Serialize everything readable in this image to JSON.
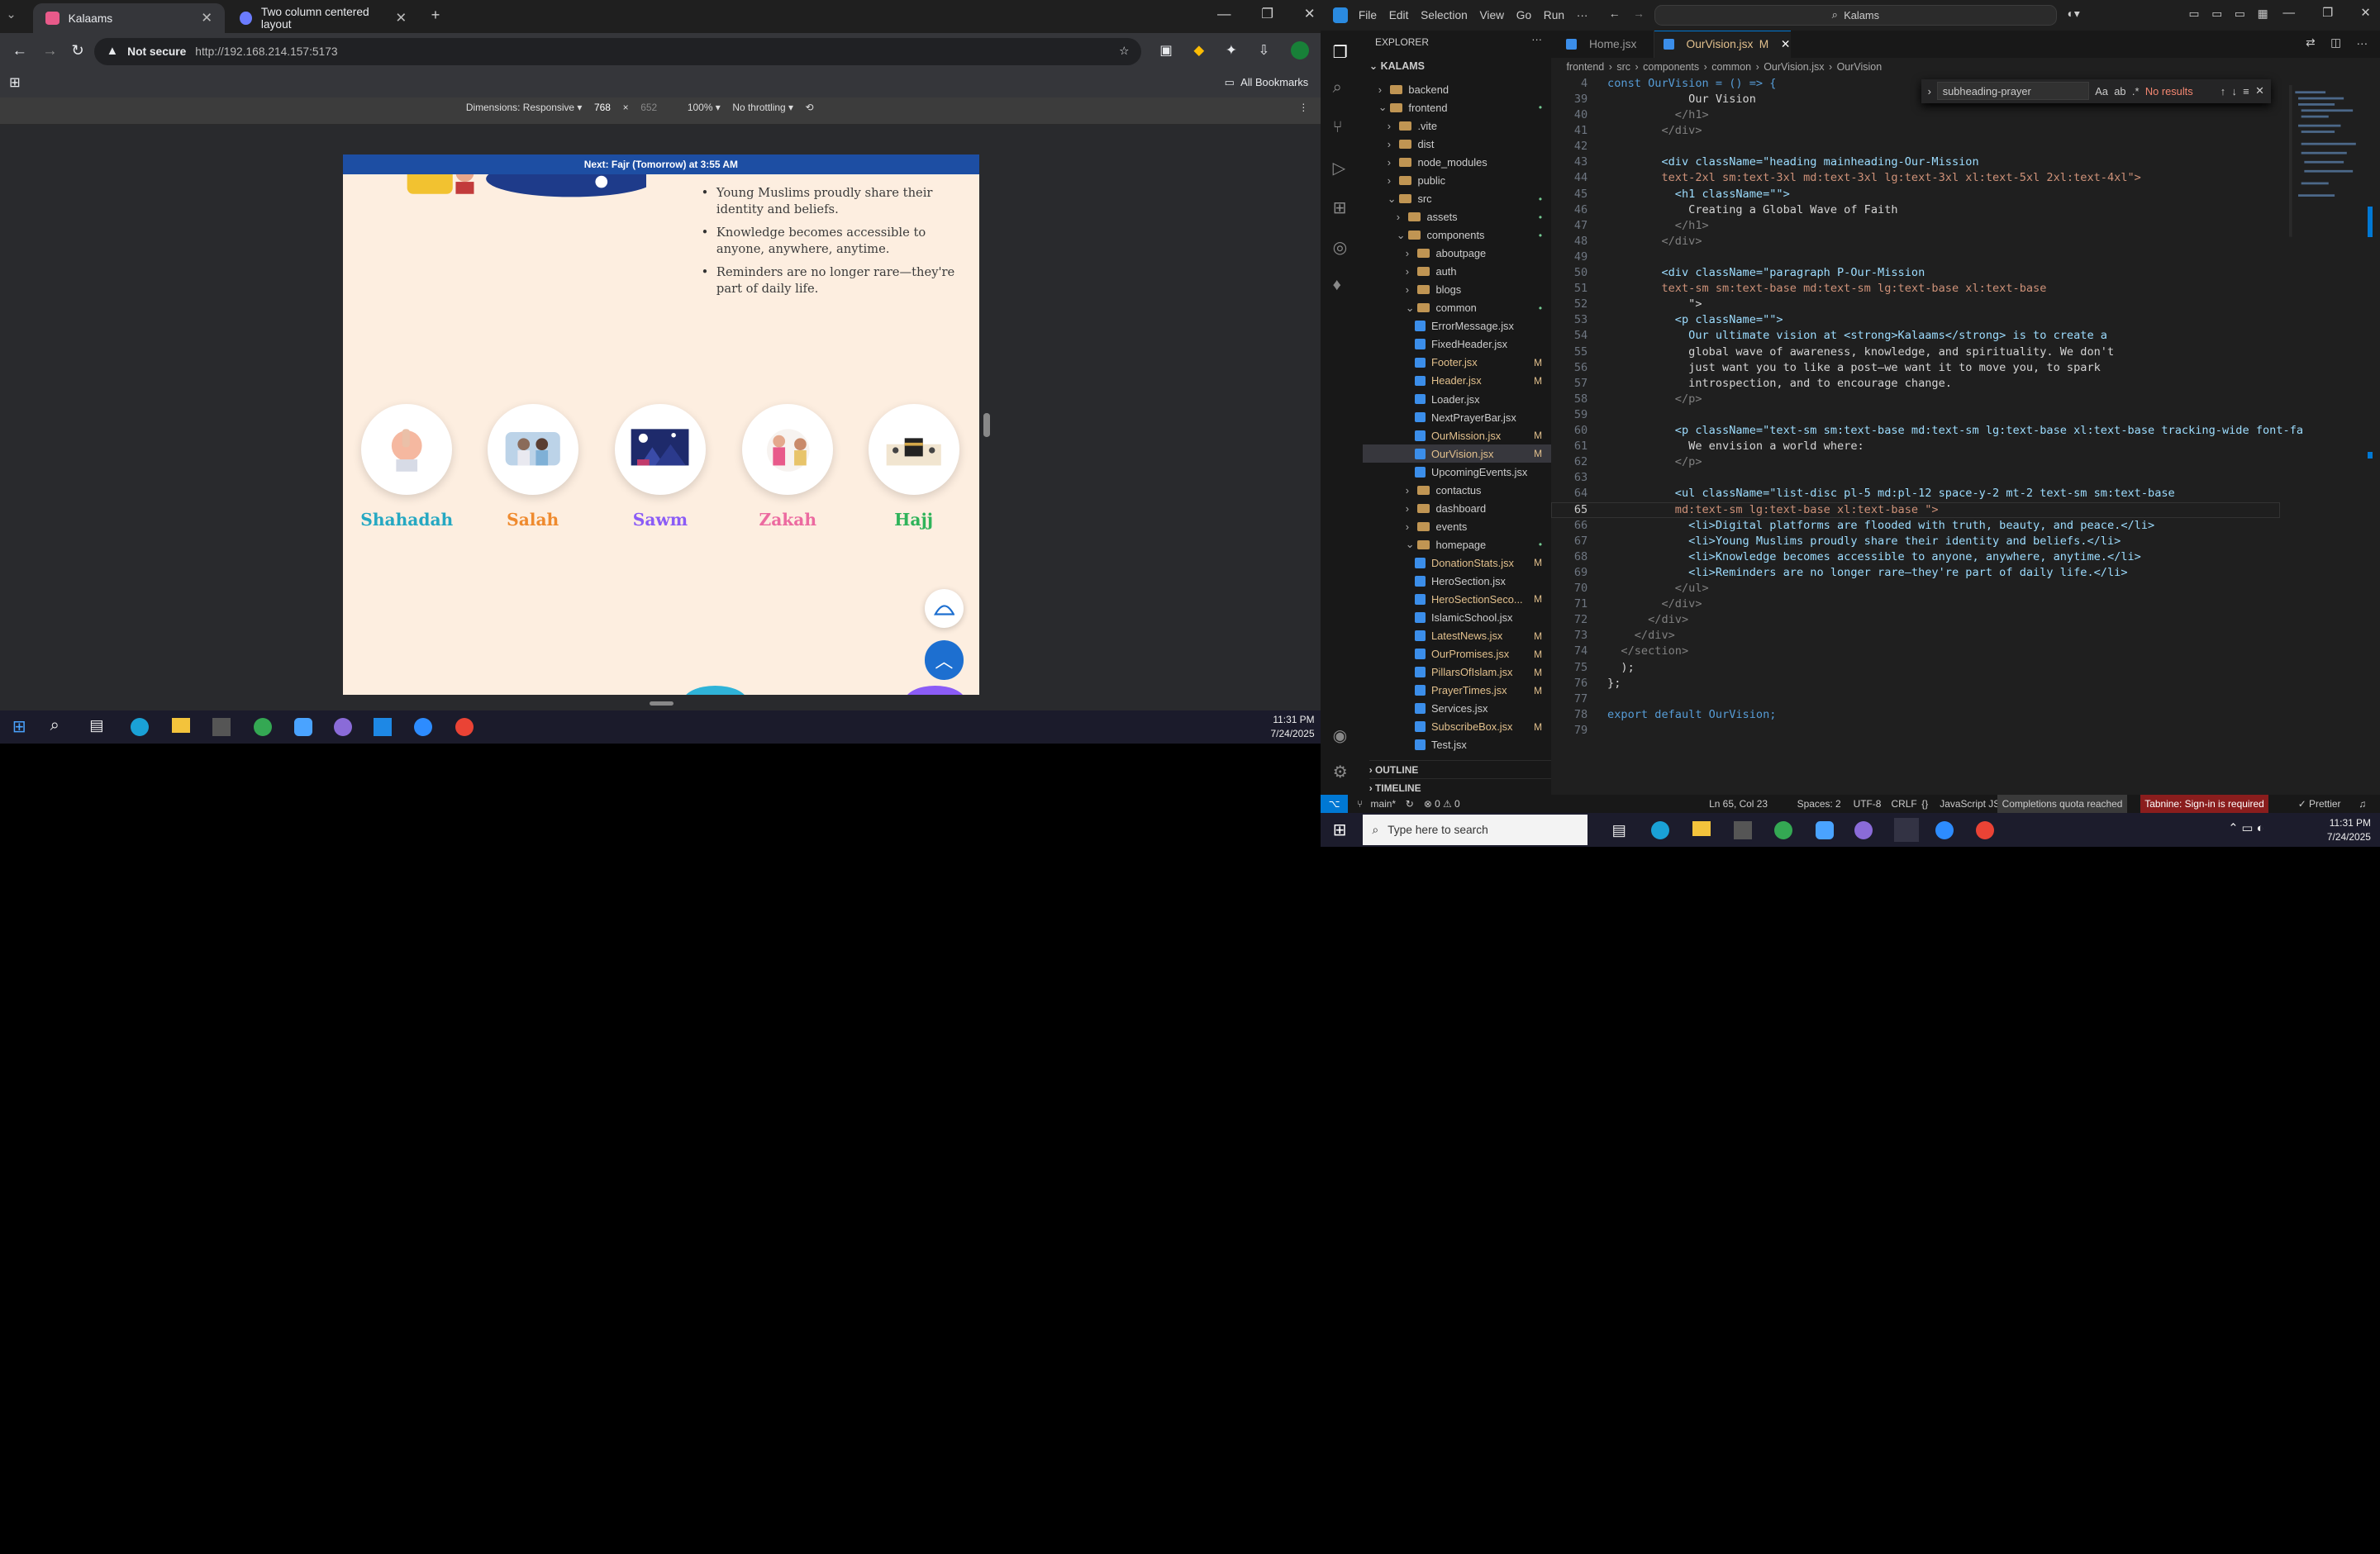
{
  "browser": {
    "tabs": [
      {
        "title": "Kalaams",
        "active": true
      },
      {
        "title": "Two column centered layout",
        "active": false
      }
    ],
    "new_tab": "+",
    "security": "Not secure",
    "url": "http://192.168.214.157:5173",
    "all_bookmarks": "All Bookmarks",
    "devtools": {
      "dimensions_label": "Dimensions: Responsive ▾",
      "width": "768",
      "times": "×",
      "height": "652",
      "zoom": "100% ▾",
      "throttle": "No throttling ▾"
    }
  },
  "site": {
    "prayer_bar": "Next: Fajr (Tomorrow) at 3:55 AM",
    "bullets": [
      "Young Muslims proudly share their identity and beliefs.",
      "Knowledge becomes accessible to anyone, anywhere, anytime.",
      "Reminders are no longer rare—they're part of daily life."
    ],
    "pillars": [
      {
        "label": "Shahadah",
        "color": "#26a8c2"
      },
      {
        "label": "Salah",
        "color": "#ef8a2e"
      },
      {
        "label": "Sawm",
        "color": "#8b5cf6"
      },
      {
        "label": "Zakah",
        "color": "#ec6aa0"
      },
      {
        "label": "Hajj",
        "color": "#2fb35a"
      }
    ]
  },
  "taskbar_left": {
    "time": "11:31 PM",
    "date": "7/24/2025"
  },
  "vscode": {
    "menu": [
      "File",
      "Edit",
      "Selection",
      "View",
      "Go",
      "Run",
      "···"
    ],
    "search": "Kalams",
    "explorer_title": "EXPLORER",
    "root": "KALAMS",
    "tree": [
      {
        "name": "backend",
        "type": "folder",
        "indent": 1,
        "arrow": "›"
      },
      {
        "name": "frontend",
        "type": "folder",
        "indent": 1,
        "arrow": "⌄",
        "badge": "•"
      },
      {
        "name": ".vite",
        "type": "folder",
        "indent": 2,
        "arrow": "›"
      },
      {
        "name": "dist",
        "type": "folder",
        "indent": 2,
        "arrow": "›"
      },
      {
        "name": "node_modules",
        "type": "folder",
        "indent": 2,
        "arrow": "›"
      },
      {
        "name": "public",
        "type": "folder",
        "indent": 2,
        "arrow": "›"
      },
      {
        "name": "src",
        "type": "folder",
        "indent": 2,
        "arrow": "⌄",
        "badge": "•"
      },
      {
        "name": "assets",
        "type": "folder",
        "indent": 3,
        "arrow": "›",
        "badge": "•"
      },
      {
        "name": "components",
        "type": "folder",
        "indent": 3,
        "arrow": "⌄",
        "badge": "•"
      },
      {
        "name": "aboutpage",
        "type": "folder",
        "indent": 4,
        "arrow": "›"
      },
      {
        "name": "auth",
        "type": "folder",
        "indent": 4,
        "arrow": "›"
      },
      {
        "name": "blogs",
        "type": "folder",
        "indent": 4,
        "arrow": "›"
      },
      {
        "name": "common",
        "type": "folder",
        "indent": 4,
        "arrow": "⌄",
        "badge": "•"
      },
      {
        "name": "ErrorMessage.jsx",
        "type": "file",
        "indent": 5
      },
      {
        "name": "FixedHeader.jsx",
        "type": "file",
        "indent": 5
      },
      {
        "name": "Footer.jsx",
        "type": "file",
        "indent": 5,
        "badge": "M"
      },
      {
        "name": "Header.jsx",
        "type": "file",
        "indent": 5,
        "badge": "M"
      },
      {
        "name": "Loader.jsx",
        "type": "file",
        "indent": 5
      },
      {
        "name": "NextPrayerBar.jsx",
        "type": "file",
        "indent": 5
      },
      {
        "name": "OurMission.jsx",
        "type": "file",
        "indent": 5,
        "badge": "M"
      },
      {
        "name": "OurVision.jsx",
        "type": "file",
        "indent": 5,
        "badge": "M",
        "selected": true
      },
      {
        "name": "UpcomingEvents.jsx",
        "type": "file",
        "indent": 5
      },
      {
        "name": "contactus",
        "type": "folder",
        "indent": 4,
        "arrow": "›"
      },
      {
        "name": "dashboard",
        "type": "folder",
        "indent": 4,
        "arrow": "›"
      },
      {
        "name": "events",
        "type": "folder",
        "indent": 4,
        "arrow": "›"
      },
      {
        "name": "homepage",
        "type": "folder",
        "indent": 4,
        "arrow": "⌄",
        "badge": "•"
      },
      {
        "name": "DonationStats.jsx",
        "type": "file",
        "indent": 5,
        "badge": "M"
      },
      {
        "name": "HeroSection.jsx",
        "type": "file",
        "indent": 5
      },
      {
        "name": "HeroSectionSeco...",
        "type": "file",
        "indent": 5,
        "badge": "M"
      },
      {
        "name": "IslamicSchool.jsx",
        "type": "file",
        "indent": 5
      },
      {
        "name": "LatestNews.jsx",
        "type": "file",
        "indent": 5,
        "badge": "M"
      },
      {
        "name": "OurPromises.jsx",
        "type": "file",
        "indent": 5,
        "badge": "M"
      },
      {
        "name": "PillarsOfIslam.jsx",
        "type": "file",
        "indent": 5,
        "badge": "M"
      },
      {
        "name": "PrayerTimes.jsx",
        "type": "file",
        "indent": 5,
        "badge": "M"
      },
      {
        "name": "Services.jsx",
        "type": "file",
        "indent": 5
      },
      {
        "name": "SubscribeBox.jsx",
        "type": "file",
        "indent": 5,
        "badge": "M"
      },
      {
        "name": "Test.jsx",
        "type": "file",
        "indent": 5
      }
    ],
    "outline": "OUTLINE",
    "timeline": "TIMELINE",
    "editor_tabs": [
      {
        "name": "Home.jsx",
        "active": false
      },
      {
        "name": "OurVision.jsx",
        "active": true,
        "badge": "M"
      }
    ],
    "breadcrumb": [
      "frontend",
      "src",
      "components",
      "common",
      "OurVision.jsx",
      "OurVision"
    ],
    "find": {
      "query": "subheading-prayer",
      "result": "No results"
    },
    "code_lines": [
      {
        "n": "4",
        "t": "const OurVision = () => {"
      },
      {
        "n": "39",
        "t": "            Our Vision"
      },
      {
        "n": "40",
        "t": "          </h1>"
      },
      {
        "n": "41",
        "t": "        </div>"
      },
      {
        "n": "42",
        "t": ""
      },
      {
        "n": "43",
        "t": "        <div className=\"heading mainheading-Our-Mission"
      },
      {
        "n": "44",
        "t": "        text-2xl sm:text-3xl md:text-3xl lg:text-3xl xl:text-5xl 2xl:text-4xl\">"
      },
      {
        "n": "45",
        "t": "          <h1 className=\"\">"
      },
      {
        "n": "46",
        "t": "            Creating a Global Wave of Faith"
      },
      {
        "n": "47",
        "t": "          </h1>"
      },
      {
        "n": "48",
        "t": "        </div>"
      },
      {
        "n": "49",
        "t": ""
      },
      {
        "n": "50",
        "t": "        <div className=\"paragraph P-Our-Mission"
      },
      {
        "n": "51",
        "t": "        text-sm sm:text-base md:text-sm lg:text-base xl:text-base"
      },
      {
        "n": "52",
        "t": "            \">"
      },
      {
        "n": "53",
        "t": "          <p className=\"\">"
      },
      {
        "n": "54",
        "t": "            Our ultimate vision at <strong>Kalaams</strong> is to create a"
      },
      {
        "n": "55",
        "t": "            global wave of awareness, knowledge, and spirituality. We don't"
      },
      {
        "n": "56",
        "t": "            just want you to like a post—we want it to move you, to spark"
      },
      {
        "n": "57",
        "t": "            introspection, and to encourage change."
      },
      {
        "n": "58",
        "t": "          </p>"
      },
      {
        "n": "59",
        "t": ""
      },
      {
        "n": "60",
        "t": "          <p className=\"text-sm sm:text-base md:text-sm lg:text-base xl:text-base tracking-wide font-fa"
      },
      {
        "n": "61",
        "t": "            We envision a world where:"
      },
      {
        "n": "62",
        "t": "          </p>"
      },
      {
        "n": "63",
        "t": ""
      },
      {
        "n": "64",
        "t": "          <ul className=\"list-disc pl-5 md:pl-12 space-y-2 mt-2 text-sm sm:text-base"
      },
      {
        "n": "65",
        "t": "          md:text-sm lg:text-base xl:text-base \">"
      },
      {
        "n": "66",
        "t": "            <li>Digital platforms are flooded with truth, beauty, and peace.</li>"
      },
      {
        "n": "67",
        "t": "            <li>Young Muslims proudly share their identity and beliefs.</li>"
      },
      {
        "n": "68",
        "t": "            <li>Knowledge becomes accessible to anyone, anywhere, anytime.</li>"
      },
      {
        "n": "69",
        "t": "            <li>Reminders are no longer rare—they're part of daily life.</li>"
      },
      {
        "n": "70",
        "t": "          </ul>"
      },
      {
        "n": "71",
        "t": "        </div>"
      },
      {
        "n": "72",
        "t": "      </div>"
      },
      {
        "n": "73",
        "t": "    </div>"
      },
      {
        "n": "74",
        "t": "  </section>"
      },
      {
        "n": "75",
        "t": "  );"
      },
      {
        "n": "76",
        "t": "};"
      },
      {
        "n": "77",
        "t": ""
      },
      {
        "n": "78",
        "t": "export default OurVision;"
      },
      {
        "n": "79",
        "t": ""
      }
    ],
    "status": {
      "branch": "main*",
      "problems": "⊗ 0 ⚠ 0",
      "position": "Ln 65, Col 23",
      "spaces": "Spaces: 2",
      "encoding": "UTF-8",
      "eol": "CRLF",
      "lang": "JavaScript JSX",
      "completions": "Completions quota reached",
      "tabnine": "Tabnine: Sign-in is required",
      "prettier": "✓ Prettier"
    }
  },
  "taskbar_right": {
    "search_placeholder": "Type here to search",
    "time": "11:31 PM",
    "date": "7/24/2025"
  }
}
